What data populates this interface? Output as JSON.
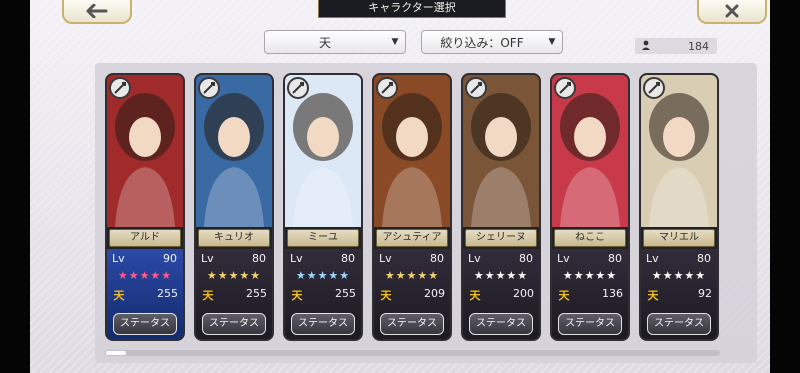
{
  "header": {
    "title": "キャラクター選択",
    "back_icon": "arrow-left",
    "close_icon": "close-x"
  },
  "filters": {
    "attribute": "天",
    "filter": "絞り込み：OFF"
  },
  "counter": {
    "value": "184",
    "icon": "person-icon"
  },
  "characters": [
    {
      "name": "アルド",
      "lv": "90",
      "stars": "★★★★★",
      "trust": "255",
      "status_label": "ステータス",
      "weapon": "sword",
      "star_color": "#ff5a8a",
      "bg": "#a12a2a"
    },
    {
      "name": "キュリオ",
      "lv": "80",
      "stars": "★★★★★",
      "trust": "255",
      "status_label": "ステータス",
      "weapon": "sword",
      "star_color": "#f2d36d",
      "bg": "#3a6aa3"
    },
    {
      "name": "ミーユ",
      "lv": "80",
      "stars": "★★★★★",
      "trust": "255",
      "status_label": "ステータス",
      "weapon": "bow",
      "star_color": "#9bd8ff",
      "bg": "#dce8f6"
    },
    {
      "name": "アシュティア",
      "lv": "80",
      "stars": "★★★★★",
      "trust": "209",
      "status_label": "ステータス",
      "weapon": "hammer",
      "star_color": "#f2d36d",
      "bg": "#8a4a26"
    },
    {
      "name": "シェリーヌ",
      "lv": "80",
      "stars": "★★★★★",
      "trust": "200",
      "status_label": "ステータス",
      "weapon": "fist",
      "star_color": "#ffffff",
      "bg": "#7a5538"
    },
    {
      "name": "ねここ",
      "lv": "80",
      "stars": "★★★★★",
      "trust": "136",
      "status_label": "ステータス",
      "weapon": "hammer",
      "star_color": "#ffffff",
      "bg": "#c83a4a"
    },
    {
      "name": "マリエル",
      "lv": "80",
      "stars": "★★★★★",
      "trust": "92",
      "status_label": "ステータス",
      "weapon": "staff",
      "star_color": "#ffffff",
      "bg": "#d9cdb4"
    }
  ],
  "labels": {
    "lv": "Lv",
    "trust_glyph": "天"
  }
}
